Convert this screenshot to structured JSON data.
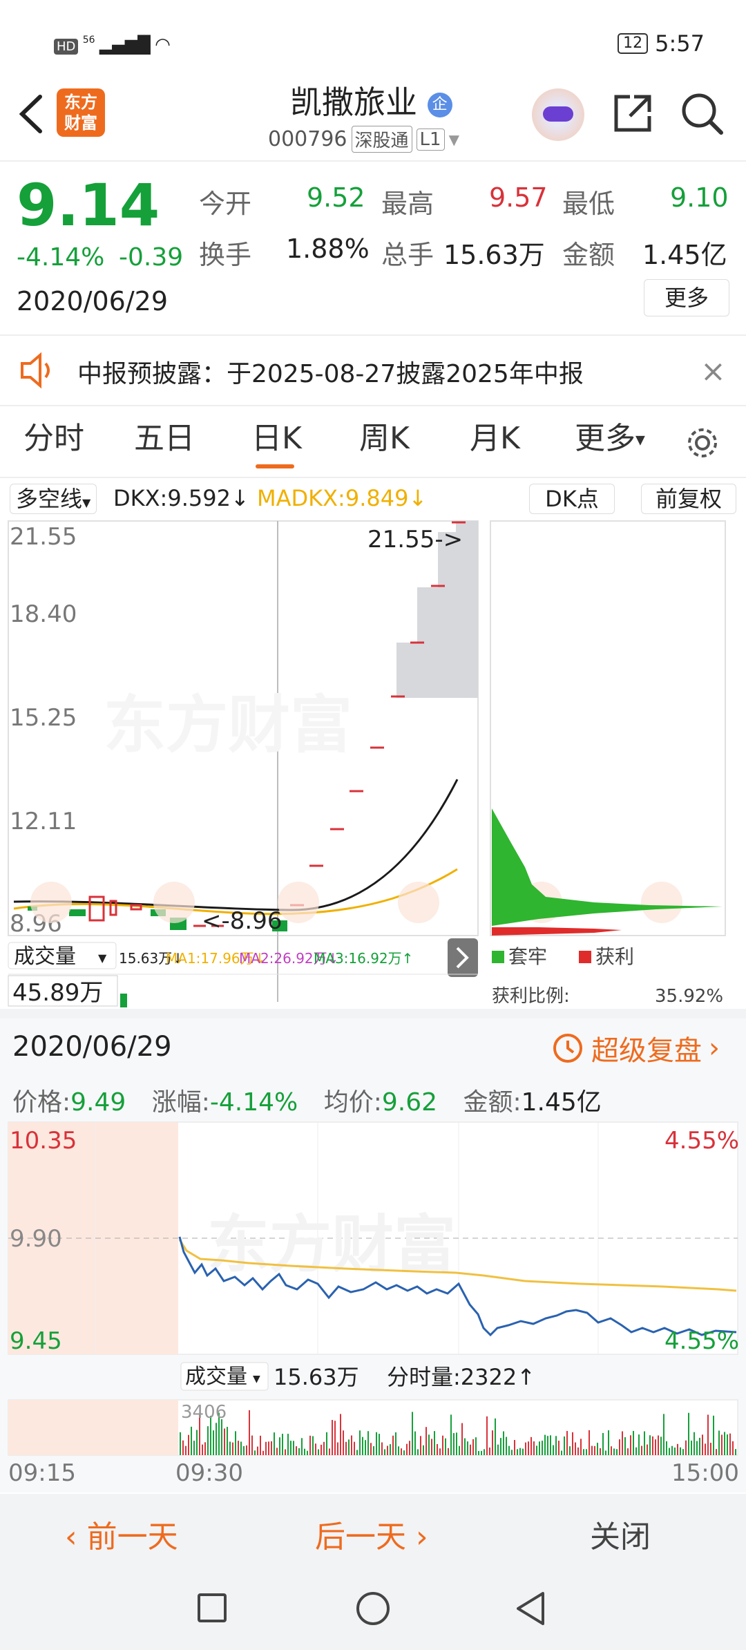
{
  "status_bar": {
    "hd": "HD",
    "net": "56",
    "battery": "12",
    "time": "5:57"
  },
  "header": {
    "logo_line1": "东方",
    "logo_line2": "财富",
    "title": "凯撒旅业",
    "badge": "企",
    "code": "000796",
    "market": "深股通",
    "level": "L1"
  },
  "quote": {
    "price": "9.14",
    "change_pct": "-4.14%",
    "change": "-0.39",
    "date": "2020/06/29",
    "open_label": "今开",
    "open": "9.52",
    "high_label": "最高",
    "high": "9.57",
    "low_label": "最低",
    "low": "9.10",
    "turnover_label": "换手",
    "turnover": "1.88%",
    "volume_label": "总手",
    "volume": "15.63万",
    "amount_label": "金额",
    "amount": "1.45亿",
    "more": "更多"
  },
  "notice": {
    "text": "中报预披露：于2025-08-27披露2025年中报"
  },
  "tabs": [
    {
      "label": "分时"
    },
    {
      "label": "五日"
    },
    {
      "label": "日K"
    },
    {
      "label": "周K"
    },
    {
      "label": "月K"
    },
    {
      "label": "更多"
    }
  ],
  "kline": {
    "indicator": "多空线",
    "dkx": "DKX:9.592",
    "madkx": "MADKX:9.849",
    "dk_points": "DK点",
    "fq": "前复权",
    "axis": [
      "21.55",
      "18.40",
      "15.25",
      "12.11",
      "8.96"
    ],
    "max_label": "21.55->",
    "min_label": "<-8.96",
    "vol_label": "成交量",
    "vol_stats": "15.63万↓",
    "ma1": "MA1:17.96万↓",
    "ma2": "MA2:26.92万↓",
    "ma3": "MA3:16.92万↑",
    "vol_value": "45.89万",
    "legend_trapped": "套牢",
    "legend_profit": "获利",
    "profit_ratio_label": "获利比例:",
    "profit_ratio": "35.92%",
    "colors": {
      "dkx": "#1a1a1a",
      "madkx": "#f0b000",
      "up": "#d8323a",
      "down": "#15a03a",
      "cost_green": "#2fb52f",
      "cost_red": "#e02b2b"
    }
  },
  "review": {
    "date": "2020/06/29",
    "super_review": "超级复盘",
    "price_label": "价格:",
    "price": "9.49",
    "chg_label": "涨幅:",
    "chg": "-4.14%",
    "avg_label": "均价:",
    "avg": "9.62",
    "amount_label": "金额:",
    "amount": "1.45亿",
    "axis_top": "10.35",
    "axis_mid": "9.90",
    "axis_bot": "9.45",
    "pct_top": "4.55%",
    "pct_bot": "4.55%",
    "vol_label": "成交量",
    "vol_total": "15.63万",
    "tick_vol": "分时量:2322↑",
    "vol_max": "3406",
    "time_start": "09:15",
    "time_open": "09:30",
    "time_end": "15:00",
    "prev_day": "前一天",
    "next_day": "后一天",
    "close": "关闭"
  },
  "watermark": "东方财富"
}
